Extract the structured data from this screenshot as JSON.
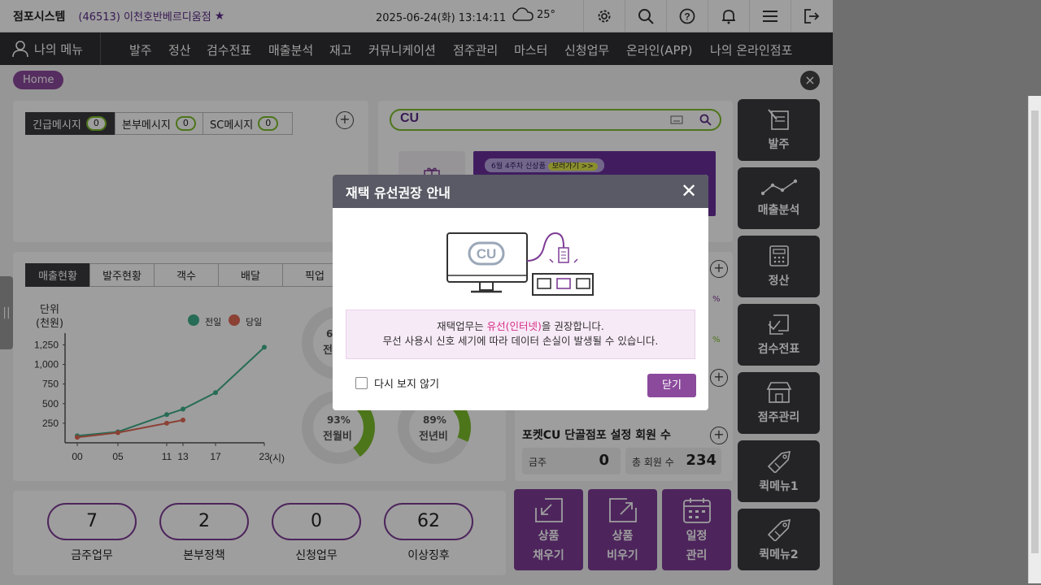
{
  "header": {
    "system_title": "점포시스템",
    "store": "(46513) 이천호반베르디움점",
    "datetime": "2025-06-24(화) 13:14:11",
    "temperature": "25°"
  },
  "nav": {
    "my_menu": "나의 메뉴",
    "items": [
      "발주",
      "정산",
      "검수전표",
      "매출분석",
      "재고",
      "커뮤니케이션",
      "점주관리",
      "마스터",
      "신청업무",
      "온라인(APP)",
      "나의 온라인점포"
    ]
  },
  "breadcrumb": {
    "home": "Home"
  },
  "messages": {
    "tabs": [
      {
        "label": "긴급메시지",
        "count": "0"
      },
      {
        "label": "본부메시지",
        "count": "0"
      },
      {
        "label": "SC메시지",
        "count": "0"
      }
    ]
  },
  "search": {
    "logo": "CU"
  },
  "banner": {
    "text": "6월 4주차 신상품",
    "badge": "보러가기 >>"
  },
  "sales": {
    "tabs": [
      "매출현황",
      "발주현황",
      "객수",
      "배달",
      "픽업"
    ],
    "unit_label": "단위",
    "unit_value": "(천원)",
    "legend_prev": "전일",
    "legend_today": "당일",
    "x_unit": "(시)",
    "donuts": [
      {
        "pct": "93%",
        "label": "전월비"
      },
      {
        "pct": "89%",
        "label": "전년비"
      }
    ],
    "donuts_partial": [
      {
        "pct": "6",
        "label": "전"
      }
    ]
  },
  "chart_data": {
    "type": "line",
    "x": [
      "00",
      "05",
      "11",
      "13",
      "17",
      "23"
    ],
    "yticks": [
      "1,250",
      "1,000",
      "750",
      "500",
      "250"
    ],
    "ylim": [
      0,
      1400
    ],
    "series": [
      {
        "name": "전일",
        "color": "#3fae8c",
        "values": [
          90,
          140,
          360,
          430,
          640,
          1220
        ]
      },
      {
        "name": "당일",
        "color": "#e06a55",
        "values": [
          70,
          130,
          250,
          290,
          null,
          null
        ]
      }
    ]
  },
  "pocket_cu": {
    "title": "포켓CU 단골점포 설정 회원 수",
    "this_week_label": "금주",
    "this_week_value": "0",
    "total_label": "총 회원 수",
    "total_value": "234"
  },
  "stats": [
    {
      "value": "7",
      "label": "금주업무"
    },
    {
      "value": "2",
      "label": "본부정책"
    },
    {
      "value": "0",
      "label": "신청업무"
    },
    {
      "value": "62",
      "label": "이상징후"
    }
  ],
  "actions": [
    {
      "line1": "상품",
      "line2": "채우기"
    },
    {
      "line1": "상품",
      "line2": "비우기"
    },
    {
      "line1": "일정",
      "line2": "관리"
    }
  ],
  "side_menu": [
    "발주",
    "매출분석",
    "정산",
    "검수전표",
    "점주관리",
    "퀵메뉴1",
    "퀵메뉴2"
  ],
  "partial_pct": [
    "%",
    "%"
  ],
  "modal": {
    "title": "재택 유선권장 안내",
    "logo": "CU",
    "notice_prefix": "재택업무는 ",
    "notice_highlight": "유선(인터넷)",
    "notice_suffix": "을 권장합니다.",
    "notice_line2": "무선 사용시 신호 세기에 따라 데이터 손실이 발생될 수 있습니다.",
    "dont_show": "다시 보지 않기",
    "close_btn": "닫기"
  },
  "colors": {
    "brand": "#7d3c95",
    "dark": "#3a3a40",
    "accent_green": "#7cbd2a",
    "highlight": "#d62e86"
  }
}
